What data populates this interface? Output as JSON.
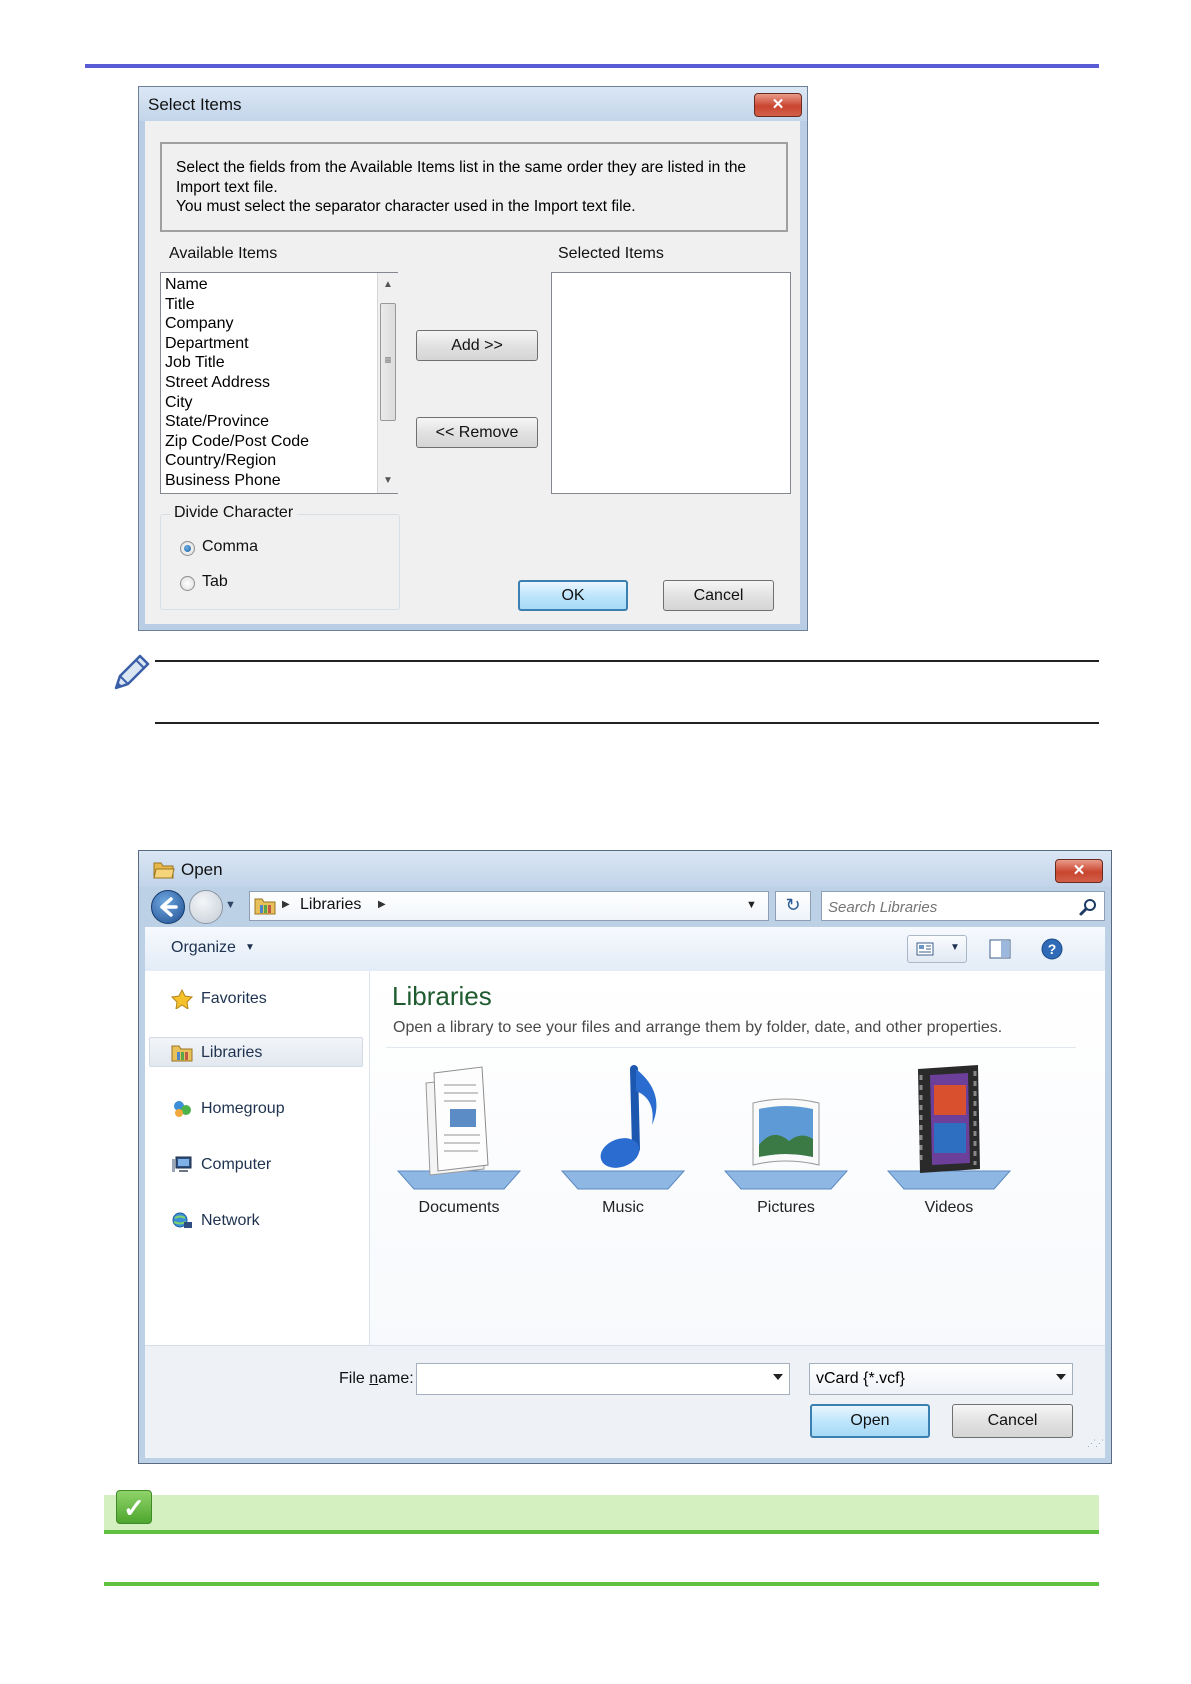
{
  "select_items_dialog": {
    "title": "Select Items",
    "close_glyph": "✕",
    "instructions": [
      "Select the fields from the Available Items list in the same order they are listed in the",
      "Import text file.",
      "You must select the separator character used in the Import text file."
    ],
    "available_label": "Available Items",
    "selected_label": "Selected Items",
    "available_items": [
      "Name",
      "Title",
      "Company",
      "Department",
      "Job Title",
      "Street Address",
      "City",
      "State/Province",
      "Zip Code/Post Code",
      "Country/Region",
      "Business Phone"
    ],
    "add_label": "Add >>",
    "remove_label": "<< Remove",
    "divide_label": "Divide Character",
    "comma_label": "Comma",
    "tab_label": "Tab",
    "selected_separator": "Comma",
    "ok_label": "OK",
    "cancel_label": "Cancel"
  },
  "open_dialog": {
    "title": "Open",
    "close_glyph": "✕",
    "breadcrumb": "Libraries",
    "search_placeholder": "Search Libraries",
    "organize_label": "Organize",
    "nav": {
      "favorites": "Favorites",
      "libraries": "Libraries",
      "homegroup": "Homegroup",
      "computer": "Computer",
      "network": "Network"
    },
    "heading": "Libraries",
    "subtitle": "Open a library to see your files and arrange them by folder, date, and other properties.",
    "libraries": [
      "Documents",
      "Music",
      "Pictures",
      "Videos"
    ],
    "filename_label_pre": "File ",
    "filename_label_key": "n",
    "filename_label_post": "ame:",
    "filename_value": "",
    "filetype_value": "vCard {*.vcf}",
    "open_label": "Open",
    "cancel_label": "Cancel"
  },
  "colors": {
    "top_rule": "#5b5bd6",
    "banner": "#d4f0c0",
    "banner_line": "#60c040",
    "library_heading": "#1e5b2e"
  }
}
